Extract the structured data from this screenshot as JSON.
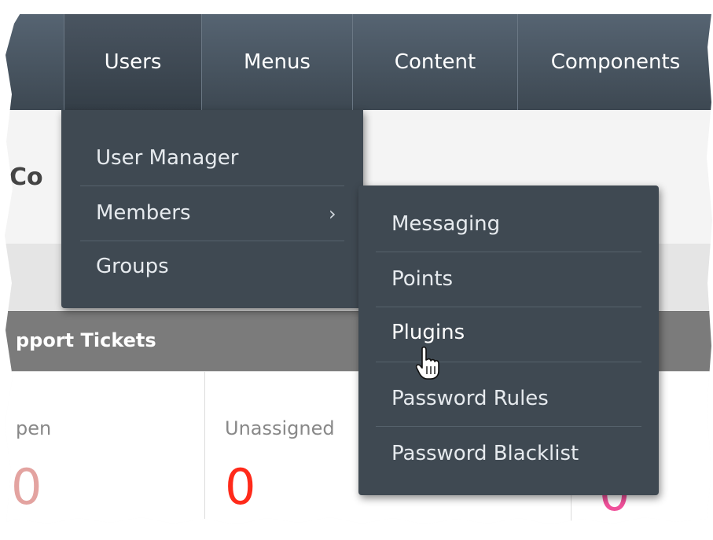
{
  "nav": {
    "items": [
      "Users",
      "Menus",
      "Content",
      "Components"
    ]
  },
  "page": {
    "title_fragment": "Co",
    "section_title": "pport Tickets"
  },
  "stats": {
    "open_label": "pen",
    "open_value": "0",
    "unassigned_label": "Unassigned",
    "unassigned_value": "0",
    "third_value": "0"
  },
  "users_menu": {
    "items": [
      "User Manager",
      "Members",
      "Groups"
    ],
    "members_chevron": "›"
  },
  "members_submenu": {
    "items": [
      "Messaging",
      "Points",
      "Plugins",
      "Password Rules",
      "Password Blacklist"
    ]
  },
  "colors": {
    "nav_bg": "#4a5561",
    "menu_bg": "#3f4952",
    "zero_red": "#ff2a1a",
    "zero_pink": "#f0509a",
    "zero_faded": "#e3a3a0"
  },
  "cursor": {
    "icon": "hand-pointer-icon"
  }
}
